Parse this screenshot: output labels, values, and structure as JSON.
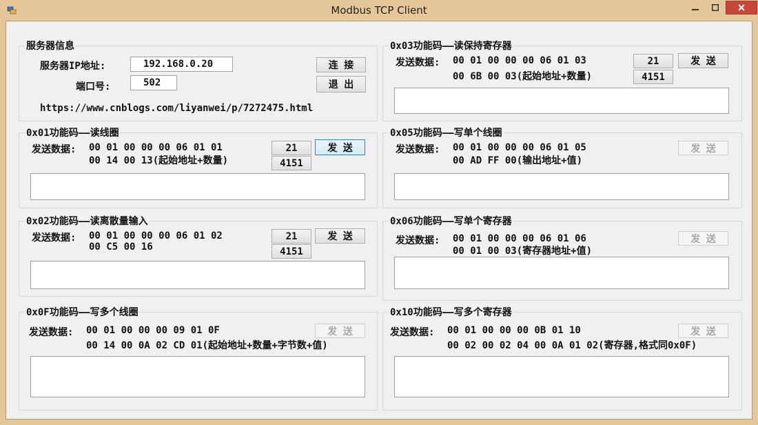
{
  "window": {
    "title": "Modbus TCP Client"
  },
  "server": {
    "group_title": "服务器信息",
    "ip_label": "服务器IP地址:",
    "ip_value": "192.168.0.20",
    "port_label": "端口号:",
    "port_value": "502",
    "connect_label": "连 接",
    "exit_label": "退 出",
    "link": "https://www.cnblogs.com/liyanwei/p/7272475.html"
  },
  "common": {
    "send_label": "发 送",
    "btn_21": "21",
    "btn_4151": "4151"
  },
  "fc01": {
    "title": "0x01功能码——读线圈",
    "prefix": "发送数据:",
    "line1": "00 01 00 00 00 06 01 01",
    "line2": "00 14 00 13(起始地址+数量)"
  },
  "fc02": {
    "title": "0x02功能码——读离散量输入",
    "prefix": "发送数据:",
    "line1": "00 01 00 00 00 06 01 02",
    "line2": "00 C5 00 16"
  },
  "fc0f": {
    "title": "0x0F功能码——写多个线圈",
    "prefix": "发送数据:",
    "line1": "00 01 00 00 00 09 01 0F",
    "line2": "00 14 00 0A 02 CD 01(起始地址+数量+字节数+值)"
  },
  "fc03": {
    "title": "0x03功能码——读保持寄存器",
    "prefix": "发送数据:",
    "line1": "00 01 00 00 00 06 01 03",
    "line2": "00 6B 00 03(起始地址+数量)"
  },
  "fc05": {
    "title": "0x05功能码——写单个线圈",
    "prefix": "发送数据:",
    "line1": "00 01 00 00 00 06 01 05",
    "line2": "00 AD FF 00(输出地址+值)"
  },
  "fc06": {
    "title": "0x06功能码——写单个寄存器",
    "prefix": "发送数据:",
    "line1": "00 01 00 00 00 06 01 06",
    "line2": "00 01 00 03(寄存器地址+值)"
  },
  "fc10": {
    "title": "0x10功能码——写多个寄存器",
    "prefix": "发送数据:",
    "line1": "00 01 00 00 00 0B 01 10",
    "line2": "00 02 00 02 04 00 0A 01 02(寄存器,格式同0x0F)"
  }
}
